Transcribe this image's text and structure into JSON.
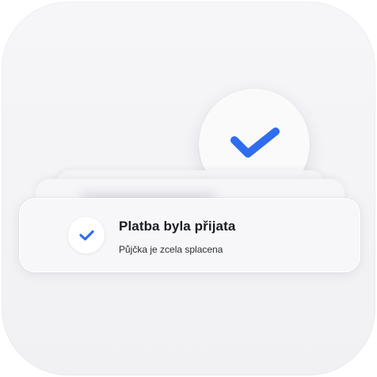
{
  "notification": {
    "title": "Platba byla přijata",
    "subtitle": "Půjčka je zcela splacena"
  },
  "icons": {
    "hero": "checkmark-icon",
    "badge": "checkmark-icon"
  },
  "colors": {
    "accent": "#2f6df0",
    "tile_background": "#f3f3f6"
  }
}
